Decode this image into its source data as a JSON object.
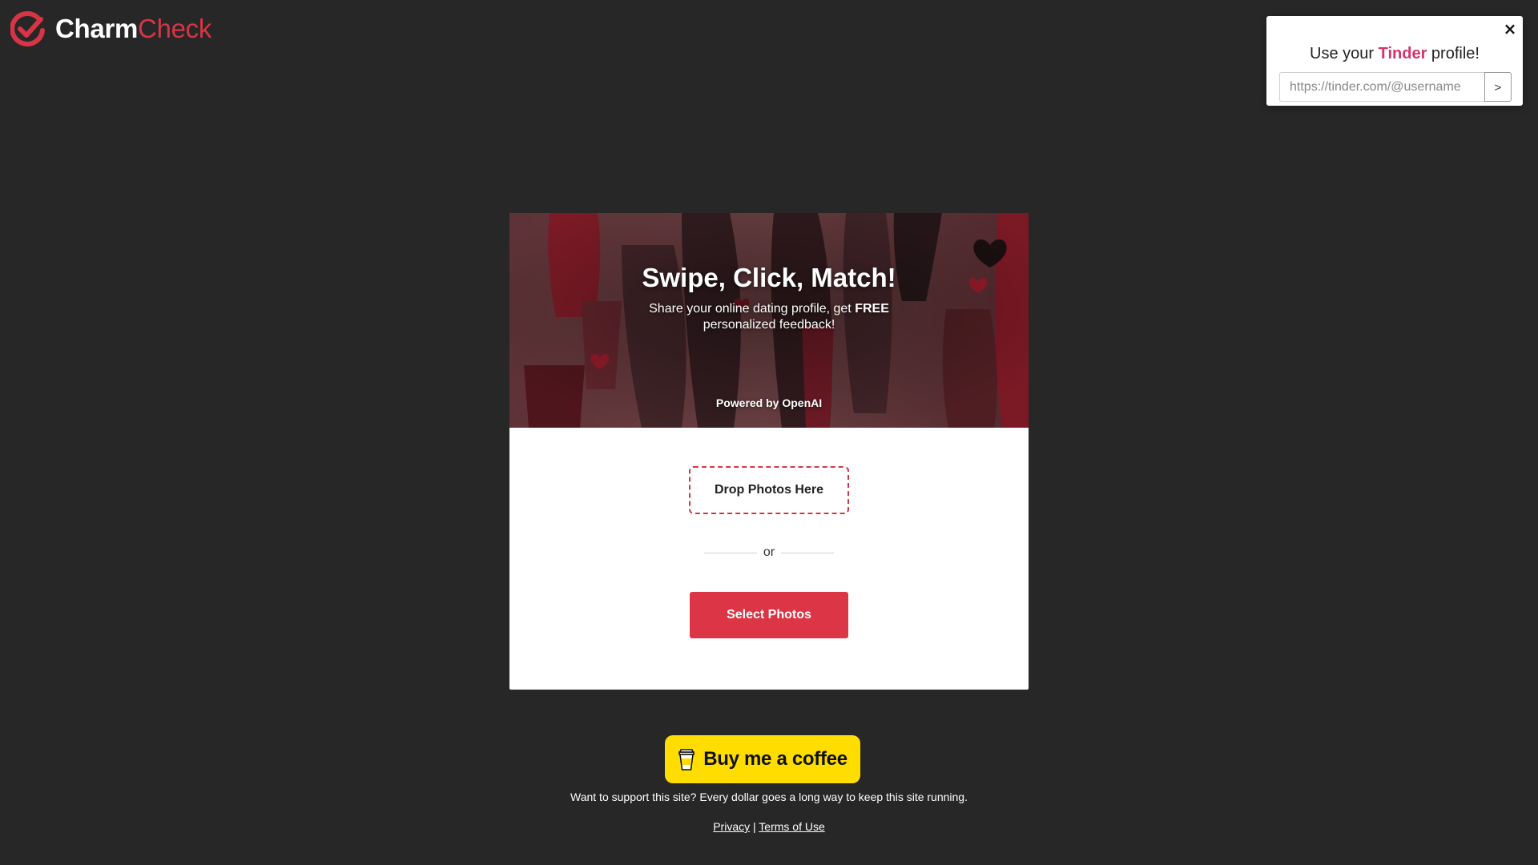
{
  "brand": {
    "name_part1": "Charm",
    "name_part2": "Check",
    "accent_color": "#d73545"
  },
  "tinder_popup": {
    "title_prefix": "Use your ",
    "title_brand": "Tinder",
    "title_suffix": " profile!",
    "input_placeholder": "https://tinder.com/@username",
    "submit_label": ">",
    "close_label": "×",
    "brand_color": "#d6336c"
  },
  "hero": {
    "title": "Swipe, Click, Match!",
    "subtitle_prefix": "Share your online dating profile, get ",
    "subtitle_bold": "FREE",
    "subtitle_suffix": " personalized feedback!",
    "powered_by": "Powered by OpenAI"
  },
  "upload": {
    "drop_label": "Drop Photos Here",
    "or_label": "or",
    "select_label": "Select Photos",
    "button_color": "#dc3545"
  },
  "coffee": {
    "label": "Buy me a coffee",
    "icon": "coffee-cup-icon",
    "color": "#ffdd00"
  },
  "support_text": "Want to support this site? Every dollar goes a long way to keep this site running.",
  "footer": {
    "privacy": "Privacy",
    "separator": "|",
    "terms": "Terms of Use"
  },
  "colors": {
    "page_background": "#272727"
  }
}
